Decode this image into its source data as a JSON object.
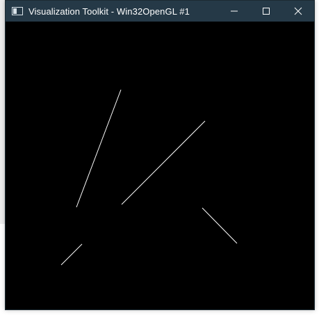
{
  "window": {
    "title": "Visualization Toolkit - Win32OpenGL #1",
    "titlebar_color": "#253947",
    "icons": {
      "app": "vtk-window-icon",
      "minimize": "minimize-icon",
      "maximize": "maximize-icon",
      "close": "close-icon"
    }
  },
  "render": {
    "background": "#000000",
    "line_color": "#ffffff"
  }
}
